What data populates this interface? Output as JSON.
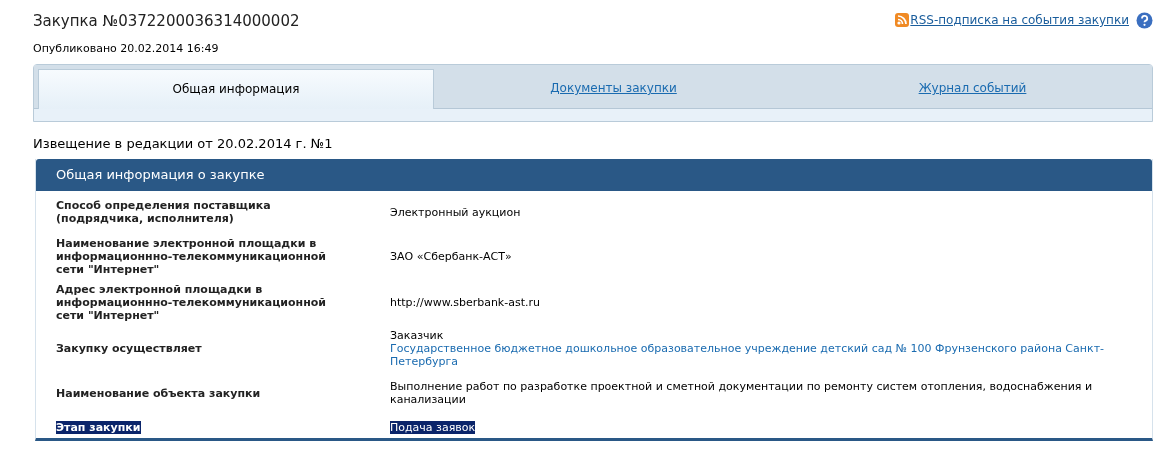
{
  "header": {
    "title": "Закупка №0372200036314000002",
    "rss_link": "RSS-подписка на события закупки",
    "published": "Опубликовано 20.02.2014 16:49"
  },
  "tabs": [
    {
      "label": "Общая информация",
      "selected": true
    },
    {
      "label": "Документы закупки",
      "selected": false
    },
    {
      "label": "Журнал событий",
      "selected": false
    }
  ],
  "notice": "Извещение в редакции от 20.02.2014 г. №1",
  "section": {
    "title": "Общая информация о закупке",
    "rows": [
      {
        "label": "Способ определения поставщика (подрядчика, исполнителя)",
        "value": [
          "Электронный аукцион"
        ],
        "highlighted": false
      },
      {
        "label": "Наименование электронной площадки в информационнно-телекоммуникационной сети \"Интернет\"",
        "value": [
          "ЗАО «Сбербанк-АСТ»"
        ],
        "highlighted": false
      },
      {
        "label": "Адрес электронной площадки в информационнно-телекоммуникационной сети \"Интернет\"",
        "value": [
          "http://www.sberbank-ast.ru"
        ],
        "highlighted": false
      },
      {
        "label": "Закупку осуществляет",
        "value": [
          "Заказчик"
        ],
        "link": "Государственное бюджетное дошкольное образовательное учреждение детский сад № 100 Фрунзенского района Санкт-Петербурга",
        "highlighted": false
      },
      {
        "label": "Наименование объекта закупки",
        "value": [
          "Выполнение работ по разработке проектной и сметной документации по ремонту систем отопления, водоснабжения и канализации"
        ],
        "highlighted": false
      },
      {
        "label": "Этап закупки",
        "value": [
          "Подача заявок"
        ],
        "highlighted": true
      }
    ]
  }
}
